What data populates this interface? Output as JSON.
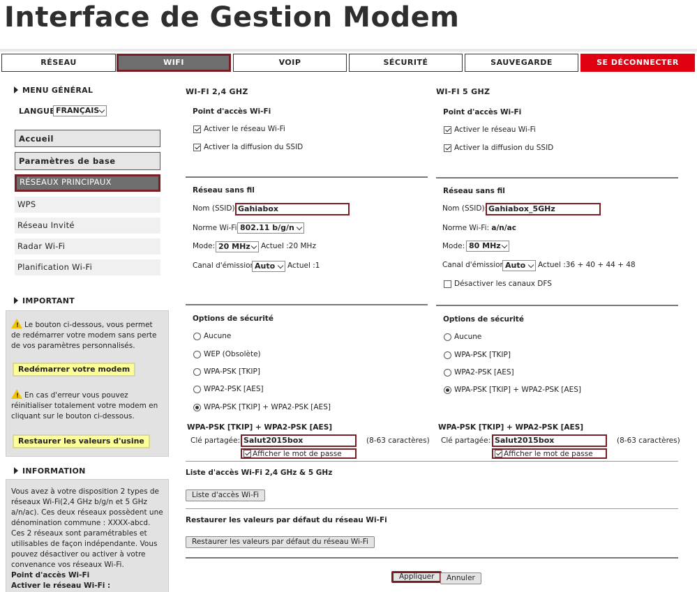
{
  "app_title": "Interface de Gestion Modem",
  "nav": [
    {
      "label": "RÉSEAU"
    },
    {
      "label": "WIFI"
    },
    {
      "label": "VOIP"
    },
    {
      "label": "SÉCURITÉ"
    },
    {
      "label": "SAUVEGARDE"
    },
    {
      "label": "SE DÉCONNECTER"
    }
  ],
  "sidebar": {
    "menu_title": "MENU GÉNÉRAL",
    "language_label": "LANGUE",
    "language_value": "FRANÇAIS",
    "buttons": [
      "Accueil",
      "Paramètres de base"
    ],
    "items": [
      "RÉSEAUX PRINCIPAUX",
      "WPS",
      "Réseau Invité",
      "Radar Wi-Fi",
      "Planification Wi-Fi"
    ],
    "important_title": "IMPORTANT",
    "important_text1": "Le bouton ci-dessous, vous permet de redémarrer votre modem sans perte de vos paramètres personnalisés.",
    "restart_button": "Redémarrer votre modem",
    "important_text2": "En cas d'erreur vous pouvez réinitialiser totalement votre modem en cliquant sur le bouton ci-dessous.",
    "factory_button": "Restaurer les valeurs d'usine",
    "information_title": "INFORMATION",
    "information_text": "Vous avez à votre disposition 2 types de réseaux Wi-Fi(2,4 GHz b/g/n et 5 GHz a/n/ac). Ces deux réseaux possèdent une dénomination commune : XXXX-abcd. Ces 2 réseaux sont paramétrables et utilisables de façon indépendante. Vous pouvez désactiver ou activer à votre convenance vos réseaux Wi-Fi.",
    "information_sub1": "Point d'accès Wi-Fi",
    "information_sub2": "Activer le réseau Wi-Fi :"
  },
  "wifi24": {
    "title": "WI-FI 2,4 GHZ",
    "ap_title": "Point d'accès Wi-Fi",
    "enable_network": "Activer le réseau Wi-Fi",
    "enable_ssid": "Activer la diffusion du SSID",
    "wireless_title": "Réseau sans fil",
    "ssid_label": "Nom (SSID):",
    "ssid_value": "Gahiabox",
    "norm_label": "Norme Wi-Fi:",
    "norm_value": "802.11 b/g/n",
    "mode_label": "Mode:",
    "mode_value": "20 MHz",
    "mode_current": "Actuel :20 MHz",
    "channel_label": "Canal d'émission:",
    "channel_value": "Auto",
    "channel_current": "Actuel :1",
    "security_title": "Options de sécurité",
    "security_options": [
      "Aucune",
      "WEP (Obsolète)",
      "WPA-PSK [TKIP]",
      "WPA2-PSK [AES]",
      "WPA-PSK [TKIP] + WPA2-PSK [AES]"
    ],
    "security_selected": "WPA-PSK [TKIP] + WPA2-PSK [AES]",
    "key_section_title": "WPA-PSK [TKIP] + WPA2-PSK [AES]",
    "key_label": "Clé partagée:",
    "key_value": "Salut2015box",
    "key_hint": "(8-63 caractères)",
    "show_password": "Afficher le mot de passe"
  },
  "wifi5": {
    "title": "WI-FI 5 GHZ",
    "ap_title": "Point d'accès Wi-Fi",
    "enable_network": "Activer le réseau Wi-Fi",
    "enable_ssid": "Activer la diffusion du SSID",
    "wireless_title": "Réseau sans fil",
    "ssid_label": "Nom (SSID):",
    "ssid_value": "Gahiabox_5GHz",
    "norm_label": "Norme Wi-Fi:",
    "norm_value": "a/n/ac",
    "mode_label": "Mode:",
    "mode_value": "80 MHz",
    "channel_label": "Canal d'émission:",
    "channel_value": "Auto",
    "channel_current": "Actuel :36 + 40 + 44 + 48",
    "dfs_label": "Désactiver les canaux DFS",
    "security_title": "Options de sécurité",
    "security_options": [
      "Aucune",
      "WPA-PSK [TKIP]",
      "WPA2-PSK [AES]",
      "WPA-PSK [TKIP] + WPA2-PSK [AES]"
    ],
    "security_selected": "WPA-PSK [TKIP] + WPA2-PSK [AES]",
    "key_section_title": "WPA-PSK [TKIP] + WPA2-PSK [AES]",
    "key_label": "Clé partagée:",
    "key_value": "Salut2015box",
    "key_hint": "(8-63 caractères)",
    "show_password": "Afficher le mot de passe"
  },
  "access_list": {
    "title": "Liste d'accès Wi-Fi 2,4 GHz & 5 GHz",
    "button": "Liste d'accès Wi-Fi"
  },
  "restore_defaults": {
    "title": "Restaurer les valeurs par défaut du réseau Wi-Fi",
    "button": "Restaurer les valeurs par défaut du réseau Wi-Fi"
  },
  "actions": {
    "apply": "Appliquer",
    "cancel": "Annuler"
  }
}
